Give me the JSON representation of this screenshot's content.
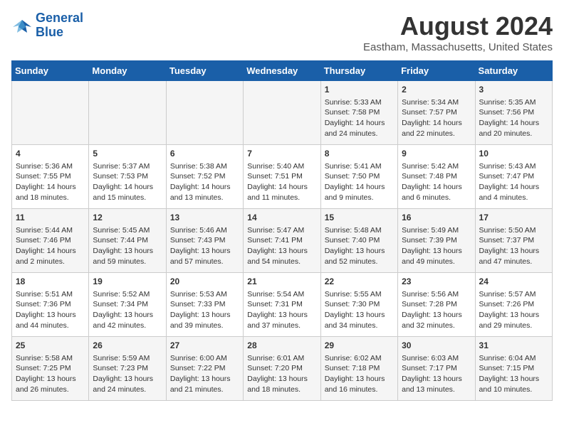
{
  "logo": {
    "line1": "General",
    "line2": "Blue"
  },
  "title": "August 2024",
  "subtitle": "Eastham, Massachusetts, United States",
  "days_of_week": [
    "Sunday",
    "Monday",
    "Tuesday",
    "Wednesday",
    "Thursday",
    "Friday",
    "Saturday"
  ],
  "weeks": [
    [
      {
        "day": "",
        "info": ""
      },
      {
        "day": "",
        "info": ""
      },
      {
        "day": "",
        "info": ""
      },
      {
        "day": "",
        "info": ""
      },
      {
        "day": "1",
        "info": "Sunrise: 5:33 AM\nSunset: 7:58 PM\nDaylight: 14 hours and 24 minutes."
      },
      {
        "day": "2",
        "info": "Sunrise: 5:34 AM\nSunset: 7:57 PM\nDaylight: 14 hours and 22 minutes."
      },
      {
        "day": "3",
        "info": "Sunrise: 5:35 AM\nSunset: 7:56 PM\nDaylight: 14 hours and 20 minutes."
      }
    ],
    [
      {
        "day": "4",
        "info": "Sunrise: 5:36 AM\nSunset: 7:55 PM\nDaylight: 14 hours and 18 minutes."
      },
      {
        "day": "5",
        "info": "Sunrise: 5:37 AM\nSunset: 7:53 PM\nDaylight: 14 hours and 15 minutes."
      },
      {
        "day": "6",
        "info": "Sunrise: 5:38 AM\nSunset: 7:52 PM\nDaylight: 14 hours and 13 minutes."
      },
      {
        "day": "7",
        "info": "Sunrise: 5:40 AM\nSunset: 7:51 PM\nDaylight: 14 hours and 11 minutes."
      },
      {
        "day": "8",
        "info": "Sunrise: 5:41 AM\nSunset: 7:50 PM\nDaylight: 14 hours and 9 minutes."
      },
      {
        "day": "9",
        "info": "Sunrise: 5:42 AM\nSunset: 7:48 PM\nDaylight: 14 hours and 6 minutes."
      },
      {
        "day": "10",
        "info": "Sunrise: 5:43 AM\nSunset: 7:47 PM\nDaylight: 14 hours and 4 minutes."
      }
    ],
    [
      {
        "day": "11",
        "info": "Sunrise: 5:44 AM\nSunset: 7:46 PM\nDaylight: 14 hours and 2 minutes."
      },
      {
        "day": "12",
        "info": "Sunrise: 5:45 AM\nSunset: 7:44 PM\nDaylight: 13 hours and 59 minutes."
      },
      {
        "day": "13",
        "info": "Sunrise: 5:46 AM\nSunset: 7:43 PM\nDaylight: 13 hours and 57 minutes."
      },
      {
        "day": "14",
        "info": "Sunrise: 5:47 AM\nSunset: 7:41 PM\nDaylight: 13 hours and 54 minutes."
      },
      {
        "day": "15",
        "info": "Sunrise: 5:48 AM\nSunset: 7:40 PM\nDaylight: 13 hours and 52 minutes."
      },
      {
        "day": "16",
        "info": "Sunrise: 5:49 AM\nSunset: 7:39 PM\nDaylight: 13 hours and 49 minutes."
      },
      {
        "day": "17",
        "info": "Sunrise: 5:50 AM\nSunset: 7:37 PM\nDaylight: 13 hours and 47 minutes."
      }
    ],
    [
      {
        "day": "18",
        "info": "Sunrise: 5:51 AM\nSunset: 7:36 PM\nDaylight: 13 hours and 44 minutes."
      },
      {
        "day": "19",
        "info": "Sunrise: 5:52 AM\nSunset: 7:34 PM\nDaylight: 13 hours and 42 minutes."
      },
      {
        "day": "20",
        "info": "Sunrise: 5:53 AM\nSunset: 7:33 PM\nDaylight: 13 hours and 39 minutes."
      },
      {
        "day": "21",
        "info": "Sunrise: 5:54 AM\nSunset: 7:31 PM\nDaylight: 13 hours and 37 minutes."
      },
      {
        "day": "22",
        "info": "Sunrise: 5:55 AM\nSunset: 7:30 PM\nDaylight: 13 hours and 34 minutes."
      },
      {
        "day": "23",
        "info": "Sunrise: 5:56 AM\nSunset: 7:28 PM\nDaylight: 13 hours and 32 minutes."
      },
      {
        "day": "24",
        "info": "Sunrise: 5:57 AM\nSunset: 7:26 PM\nDaylight: 13 hours and 29 minutes."
      }
    ],
    [
      {
        "day": "25",
        "info": "Sunrise: 5:58 AM\nSunset: 7:25 PM\nDaylight: 13 hours and 26 minutes."
      },
      {
        "day": "26",
        "info": "Sunrise: 5:59 AM\nSunset: 7:23 PM\nDaylight: 13 hours and 24 minutes."
      },
      {
        "day": "27",
        "info": "Sunrise: 6:00 AM\nSunset: 7:22 PM\nDaylight: 13 hours and 21 minutes."
      },
      {
        "day": "28",
        "info": "Sunrise: 6:01 AM\nSunset: 7:20 PM\nDaylight: 13 hours and 18 minutes."
      },
      {
        "day": "29",
        "info": "Sunrise: 6:02 AM\nSunset: 7:18 PM\nDaylight: 13 hours and 16 minutes."
      },
      {
        "day": "30",
        "info": "Sunrise: 6:03 AM\nSunset: 7:17 PM\nDaylight: 13 hours and 13 minutes."
      },
      {
        "day": "31",
        "info": "Sunrise: 6:04 AM\nSunset: 7:15 PM\nDaylight: 13 hours and 10 minutes."
      }
    ]
  ]
}
